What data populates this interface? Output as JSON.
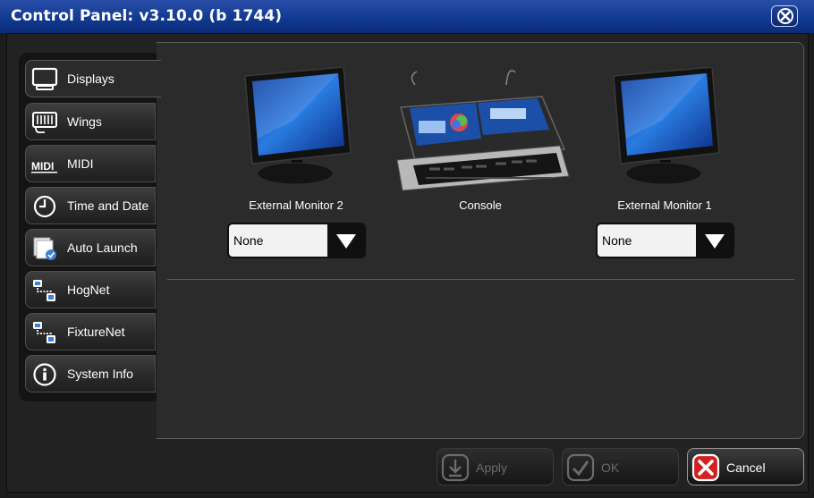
{
  "window": {
    "title": "Control Panel: v3.10.0 (b 1744)"
  },
  "sidebar": {
    "items": [
      {
        "label": "Displays",
        "icon": "monitor-icon",
        "active": true
      },
      {
        "label": "Wings",
        "icon": "wing-icon"
      },
      {
        "label": "MIDI",
        "icon": "midi-icon"
      },
      {
        "label": "Time and Date",
        "icon": "clock-icon"
      },
      {
        "label": "Auto Launch",
        "icon": "auto-launch-icon"
      },
      {
        "label": "HogNet",
        "icon": "network-icon"
      },
      {
        "label": "FixtureNet",
        "icon": "network-icon"
      },
      {
        "label": "System Info",
        "icon": "info-icon"
      }
    ]
  },
  "displays": {
    "devices": [
      {
        "label": "External Monitor 2",
        "selected": "None"
      },
      {
        "label": "Console"
      },
      {
        "label": "External Monitor 1",
        "selected": "None"
      }
    ]
  },
  "buttons": {
    "apply": "Apply",
    "ok": "OK",
    "cancel": "Cancel"
  },
  "colors": {
    "titlebar": "#123a92",
    "cancel_red": "#d42020"
  }
}
